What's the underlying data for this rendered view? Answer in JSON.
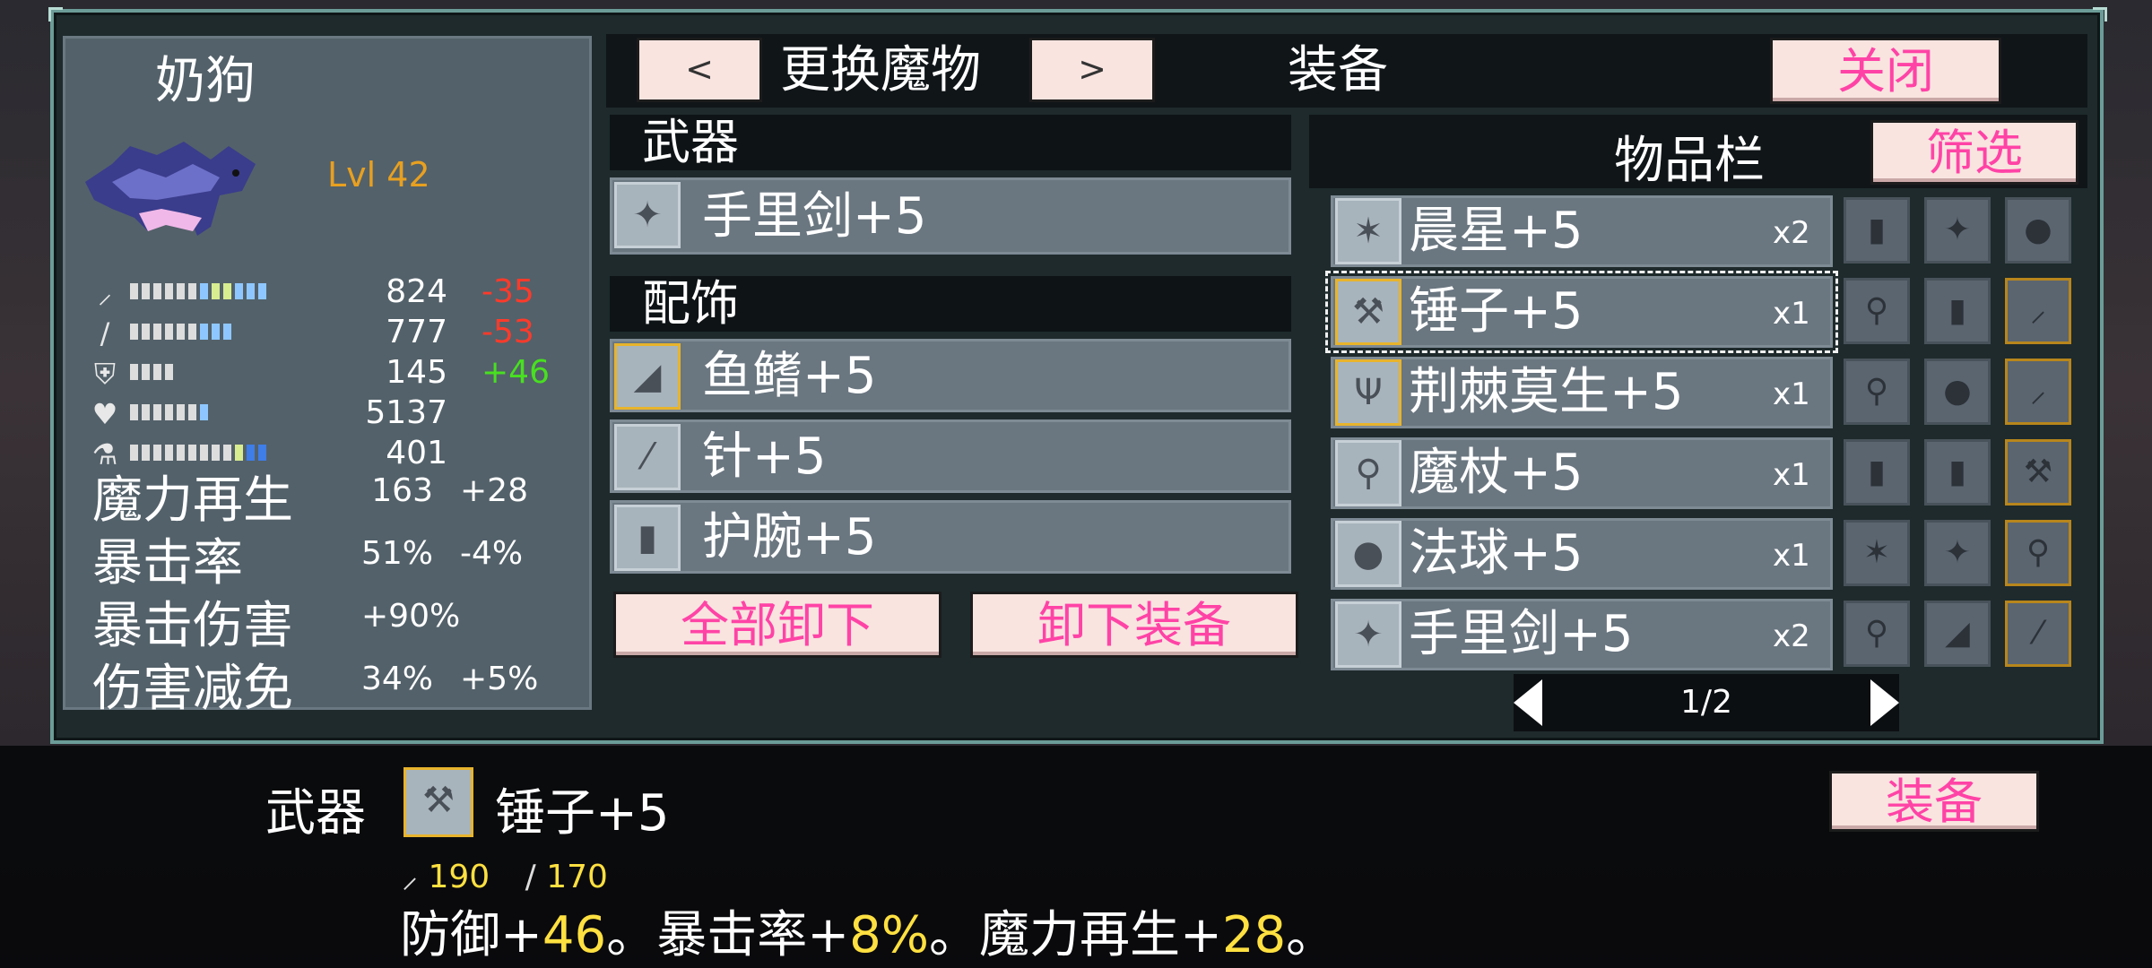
{
  "monster": {
    "name": "奶狗",
    "level": "Lvl 42",
    "stats": [
      {
        "icon": "sword-icon",
        "value": "824",
        "delta": "-35",
        "delta_type": "neg"
      },
      {
        "icon": "staff-icon",
        "value": "777",
        "delta": "-53",
        "delta_type": "neg"
      },
      {
        "icon": "shield-icon",
        "value": "145",
        "delta": "+46",
        "delta_type": "pos"
      },
      {
        "icon": "heart-icon",
        "value": "5137",
        "delta": "",
        "delta_type": ""
      },
      {
        "icon": "flask-icon",
        "value": "401",
        "delta": "",
        "delta_type": ""
      }
    ],
    "named_stats": [
      {
        "label": "魔力再生",
        "value": "163",
        "delta": "+28",
        "delta_type": "pos"
      },
      {
        "label": "暴击率",
        "value": "51%",
        "delta": "-4%",
        "delta_type": "neg"
      },
      {
        "label": "暴击伤害",
        "value": "+90%",
        "delta": "",
        "delta_type": ""
      },
      {
        "label": "伤害减免",
        "value": "34%",
        "delta": "+5%",
        "delta_type": "pos"
      }
    ]
  },
  "header": {
    "prev": "<",
    "change_monster": "更换魔物",
    "next": ">",
    "title": "装备",
    "close": "关闭"
  },
  "equipment": {
    "weapon_title": "武器",
    "weapon": {
      "icon": "shuriken-icon",
      "label": "手里剑+5"
    },
    "accessory_title": "配饰",
    "accessories": [
      {
        "icon": "fin-icon",
        "label": "鱼鳍+5"
      },
      {
        "icon": "needle-icon",
        "label": "针+5"
      },
      {
        "icon": "bracer-icon",
        "label": "护腕+5"
      }
    ],
    "unequip_all": "全部卸下",
    "unequip": "卸下装备"
  },
  "inventory": {
    "title": "物品栏",
    "filter": "筛选",
    "items": [
      {
        "icon": "morningstar-icon",
        "label": "晨星+5",
        "count": "x2"
      },
      {
        "icon": "hammer-icon",
        "label": "锤子+5",
        "count": "x1"
      },
      {
        "icon": "thornbush-icon",
        "label": "荆棘莫生+5",
        "count": "x1"
      },
      {
        "icon": "wand-icon",
        "label": "魔杖+5",
        "count": "x1"
      },
      {
        "icon": "orb-icon",
        "label": "法球+5",
        "count": "x1"
      },
      {
        "icon": "shuriken-icon",
        "label": "手里剑+5",
        "count": "x2"
      }
    ],
    "page": "1/2"
  },
  "detail": {
    "slot": "武器",
    "item": "锤子+5",
    "atk": "190",
    "matk": "170",
    "effect_parts": [
      {
        "t": "防御+",
        "c": "w"
      },
      {
        "t": "46",
        "c": "y"
      },
      {
        "t": "。暴击率+",
        "c": "w"
      },
      {
        "t": "8%",
        "c": "y"
      },
      {
        "t": "。魔力再生+",
        "c": "w"
      },
      {
        "t": "28",
        "c": "y"
      },
      {
        "t": "。",
        "c": "w"
      }
    ],
    "equip": "装备"
  }
}
